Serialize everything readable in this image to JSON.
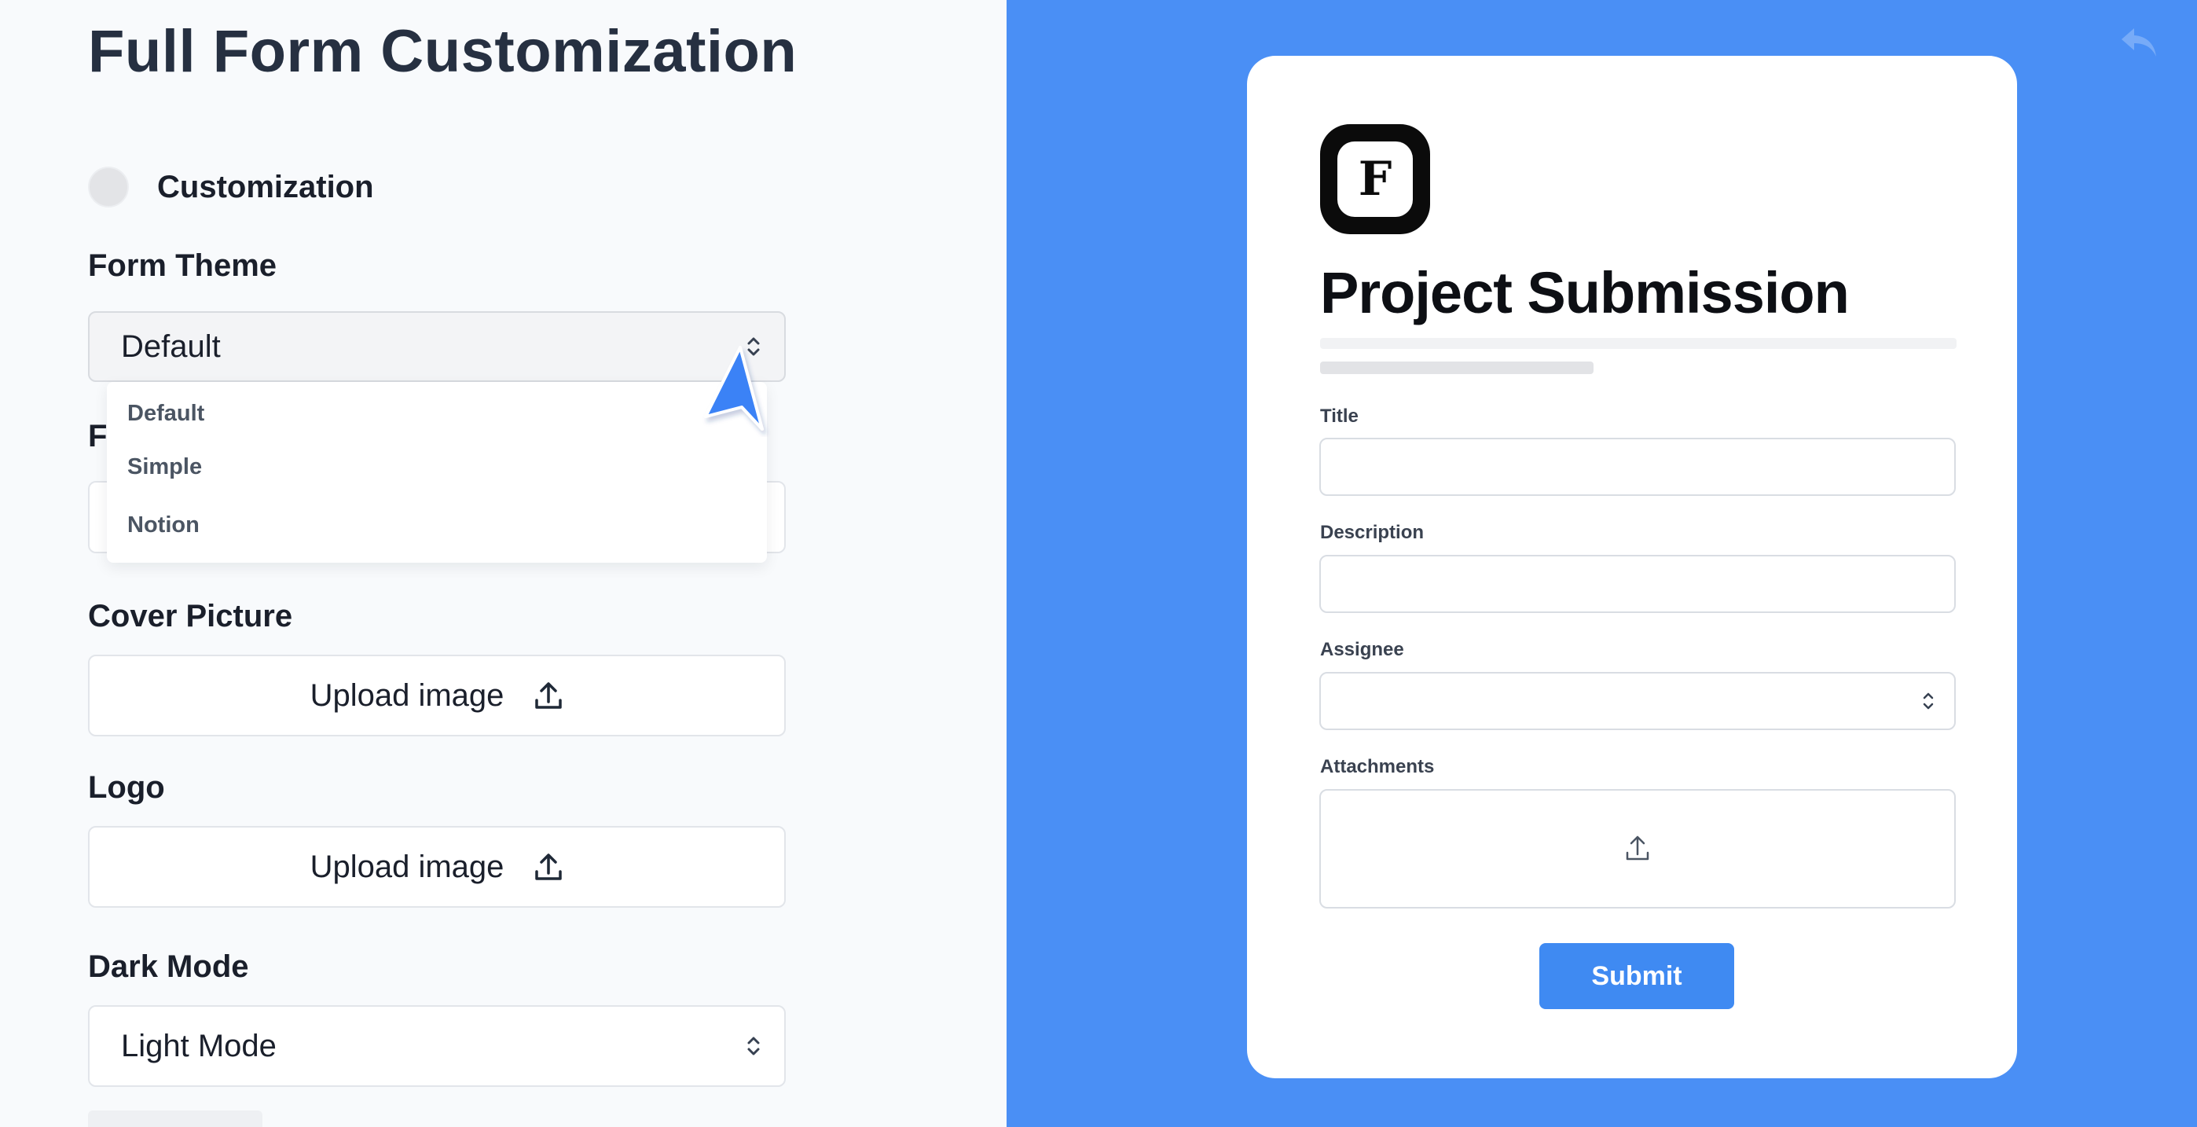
{
  "settings": {
    "title": "Full Form Customization",
    "customization_label": "Customization",
    "form_theme": {
      "label": "Form Theme",
      "selected": "Default",
      "options": [
        "Default",
        "Simple",
        "Notion"
      ]
    },
    "hidden_section_initial": "F",
    "cover_picture": {
      "label": "Cover Picture",
      "button": "Upload image"
    },
    "logo": {
      "label": "Logo",
      "button": "Upload image"
    },
    "dark_mode": {
      "label": "Dark Mode",
      "selected": "Light Mode"
    }
  },
  "preview": {
    "logo_letter": "F",
    "form_title": "Project Submission",
    "fields": {
      "title": "Title",
      "description": "Description",
      "assignee": "Assignee",
      "attachments": "Attachments"
    },
    "submit_label": "Submit"
  },
  "colors": {
    "preview_background": "#4a8ff5",
    "submit_button": "#3f8af2",
    "cursor": "#3b82f6"
  },
  "icons": [
    "upload-icon",
    "chevron-updown-icon",
    "undo-icon",
    "cursor-pointer-icon"
  ]
}
